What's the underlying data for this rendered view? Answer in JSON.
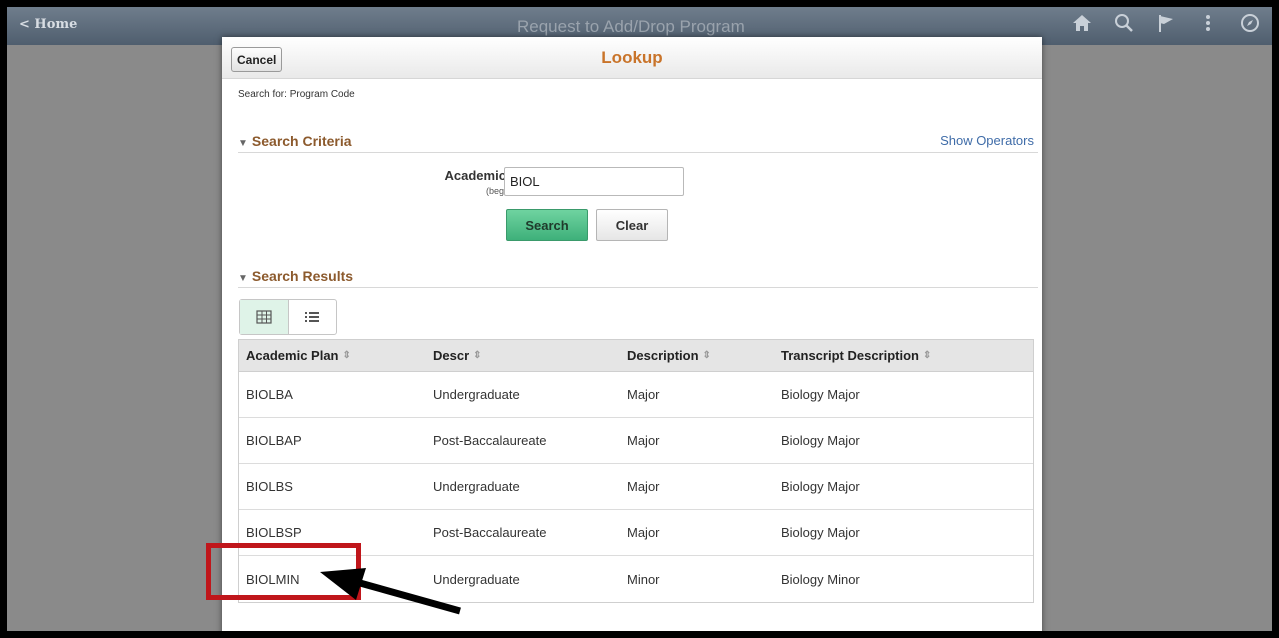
{
  "banner": {
    "home_label": "< Home",
    "title": "Request to Add/Drop Program",
    "icons": [
      "home-icon",
      "search-icon",
      "flag-icon",
      "more-icon",
      "compass-icon"
    ]
  },
  "modal": {
    "cancel_label": "Cancel",
    "title": "Lookup",
    "search_for": "Search for:  Program Code",
    "criteria": {
      "heading": "Search Criteria",
      "show_operators": "Show Operators",
      "field_label": "Academic Plan",
      "field_sublabel": "(begins with)",
      "field_value": "BIOL",
      "search_label": "Search",
      "clear_label": "Clear"
    },
    "results": {
      "heading": "Search Results",
      "columns": [
        "Academic Plan",
        "Descr",
        "Description",
        "Transcript Description"
      ],
      "rows": [
        [
          "BIOLBA",
          "Undergraduate",
          "Major",
          "Biology Major"
        ],
        [
          "BIOLBAP",
          "Post-Baccalaureate",
          "Major",
          "Biology Major"
        ],
        [
          "BIOLBS",
          "Undergraduate",
          "Major",
          "Biology Major"
        ],
        [
          "BIOLBSP",
          "Post-Baccalaureate",
          "Major",
          "Biology Major"
        ],
        [
          "BIOLMIN",
          "Undergraduate",
          "Minor",
          "Biology Minor"
        ]
      ]
    }
  },
  "colors": {
    "accent_title": "#c9742a",
    "section_heading": "#8c5a2d",
    "search_button": "#3eb07a",
    "annotation": "#c0161b"
  }
}
